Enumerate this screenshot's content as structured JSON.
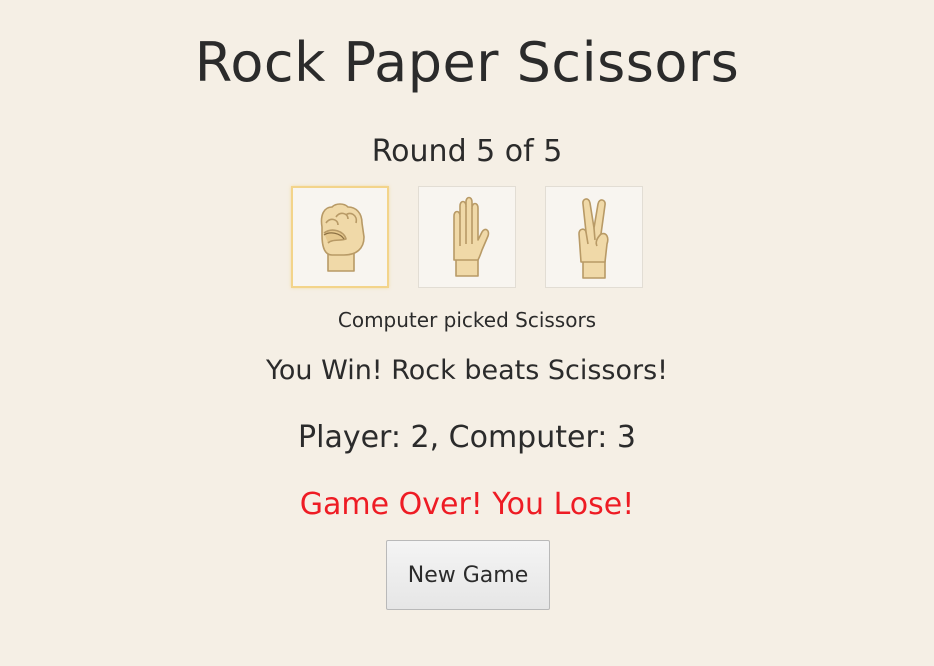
{
  "title": "Rock Paper Scissors",
  "round_text": "Round 5 of 5",
  "choices": [
    {
      "name": "Rock",
      "icon": "rock-fist-icon",
      "selected": true
    },
    {
      "name": "Paper",
      "icon": "paper-hand-icon",
      "selected": false
    },
    {
      "name": "Scissors",
      "icon": "scissors-hand-icon",
      "selected": false
    }
  ],
  "computer_pick_text": "Computer picked Scissors",
  "result_text": "You Win! Rock beats Scissors!",
  "score_text": "Player: 2, Computer: 3",
  "game_over_text": "Game Over! You Lose!",
  "new_game_label": "New Game",
  "colors": {
    "background": "#f5efe5",
    "text": "#2b2b2b",
    "game_over": "#ee1c24",
    "selected_border": "#f3d48a",
    "hand_fill": "#f0d9a8",
    "hand_stroke": "#b89a66"
  }
}
